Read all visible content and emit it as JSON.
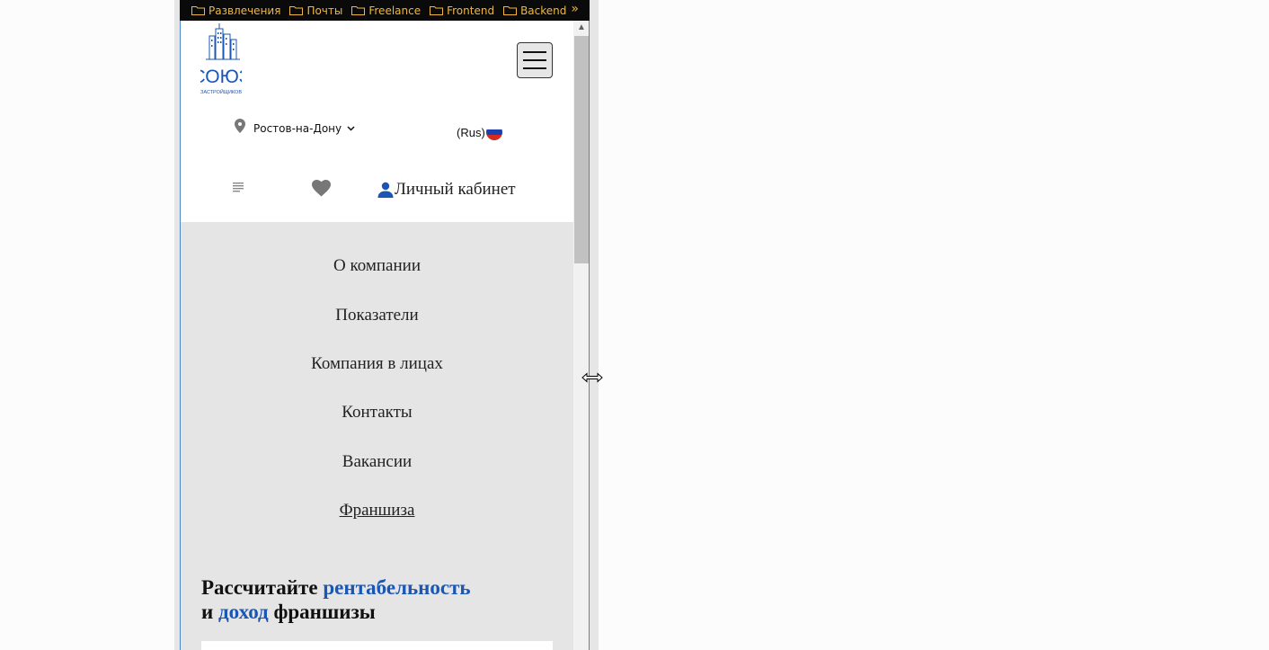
{
  "bookmarks": {
    "items": [
      {
        "label": "Развлечения"
      },
      {
        "label": "Почты"
      },
      {
        "label": "Freelance"
      },
      {
        "label": "Frontend"
      },
      {
        "label": "Backend"
      }
    ],
    "more": "»"
  },
  "header": {
    "logo_text": "СОЮЗ",
    "logo_subtext": "ЗАСТРОЙЩИКОВ",
    "city": "Ростов-на-Дону",
    "lang": "(Rus)",
    "cabinet_label": "Личный кабинет"
  },
  "menu": {
    "items": [
      {
        "label": "О компании"
      },
      {
        "label": "Показатели"
      },
      {
        "label": "Компания в лицах"
      },
      {
        "label": "Контакты"
      },
      {
        "label": "Вакансии"
      },
      {
        "label": "Франшиза"
      }
    ]
  },
  "headline": {
    "part1": "Рассчитайте ",
    "part2": "рентабельность",
    "part3": "и ",
    "part4": "доход",
    "part5": " франшизы"
  },
  "colors": {
    "accent": "#1a56b4",
    "bookmark_text": "#f0b840",
    "menu_bg": "#e5e5e5"
  }
}
